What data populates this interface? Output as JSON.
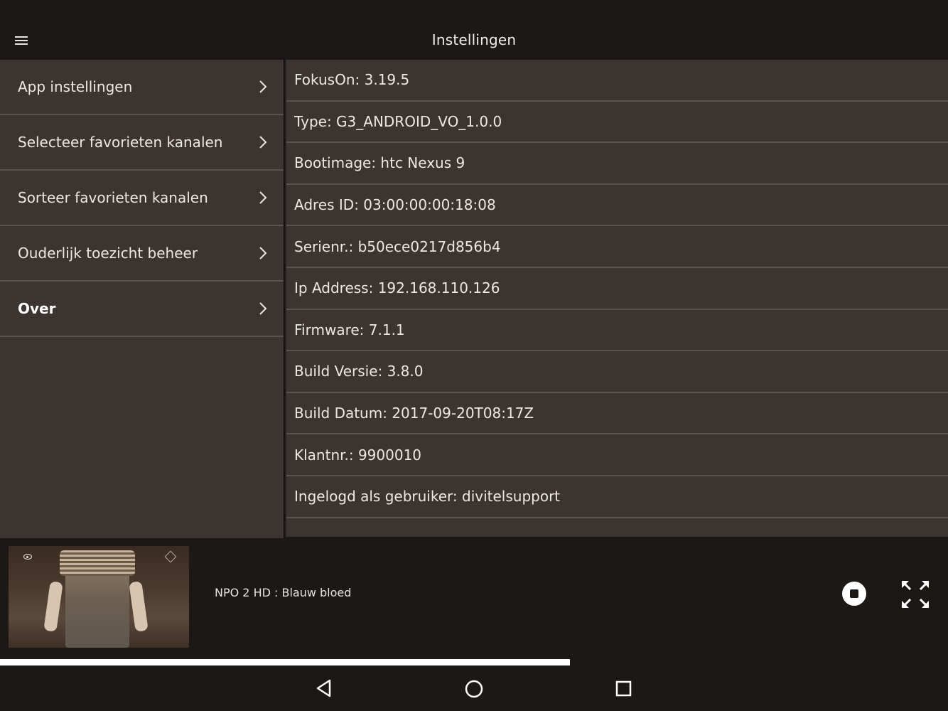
{
  "header": {
    "title": "Instellingen",
    "menu_icon": "hamburger-menu-icon"
  },
  "sidebar": {
    "items": [
      {
        "label": "App instellingen",
        "active": false
      },
      {
        "label": "Selecteer favorieten kanalen",
        "active": false
      },
      {
        "label": "Sorteer favorieten kanalen",
        "active": false
      },
      {
        "label": "Ouderlijk toezicht beheer",
        "active": false
      },
      {
        "label": "Over",
        "active": true
      }
    ]
  },
  "info": {
    "rows": [
      "FokusOn: 3.19.5",
      "Type: G3_ANDROID_VO_1.0.0",
      "Bootimage: htc Nexus 9",
      "Adres ID: 03:00:00:00:18:08",
      "Serienr.: b50ece0217d856b4",
      "Ip Address: 192.168.110.126",
      "Firmware: 7.1.1",
      "Build Versie: 3.8.0",
      "Build Datum: 2017-09-20T08:17Z",
      "Klantnr.: 9900010",
      "Ingelogd als gebruiker: divitelsupport"
    ]
  },
  "player": {
    "now_playing": "NPO 2 HD : Blauw bloed",
    "stop_icon": "stop-circle-icon",
    "fullscreen_icon": "fullscreen-expand-icon",
    "progress_fraction": 0.601
  },
  "system_nav": {
    "back_icon": "back-triangle-icon",
    "home_icon": "home-circle-icon",
    "recents_icon": "recents-square-icon"
  },
  "colors": {
    "background": "#1c1816",
    "panel": "#3b3431",
    "divider": "#5b5350",
    "text": "#ece9e5",
    "progress": "#ffffff"
  }
}
